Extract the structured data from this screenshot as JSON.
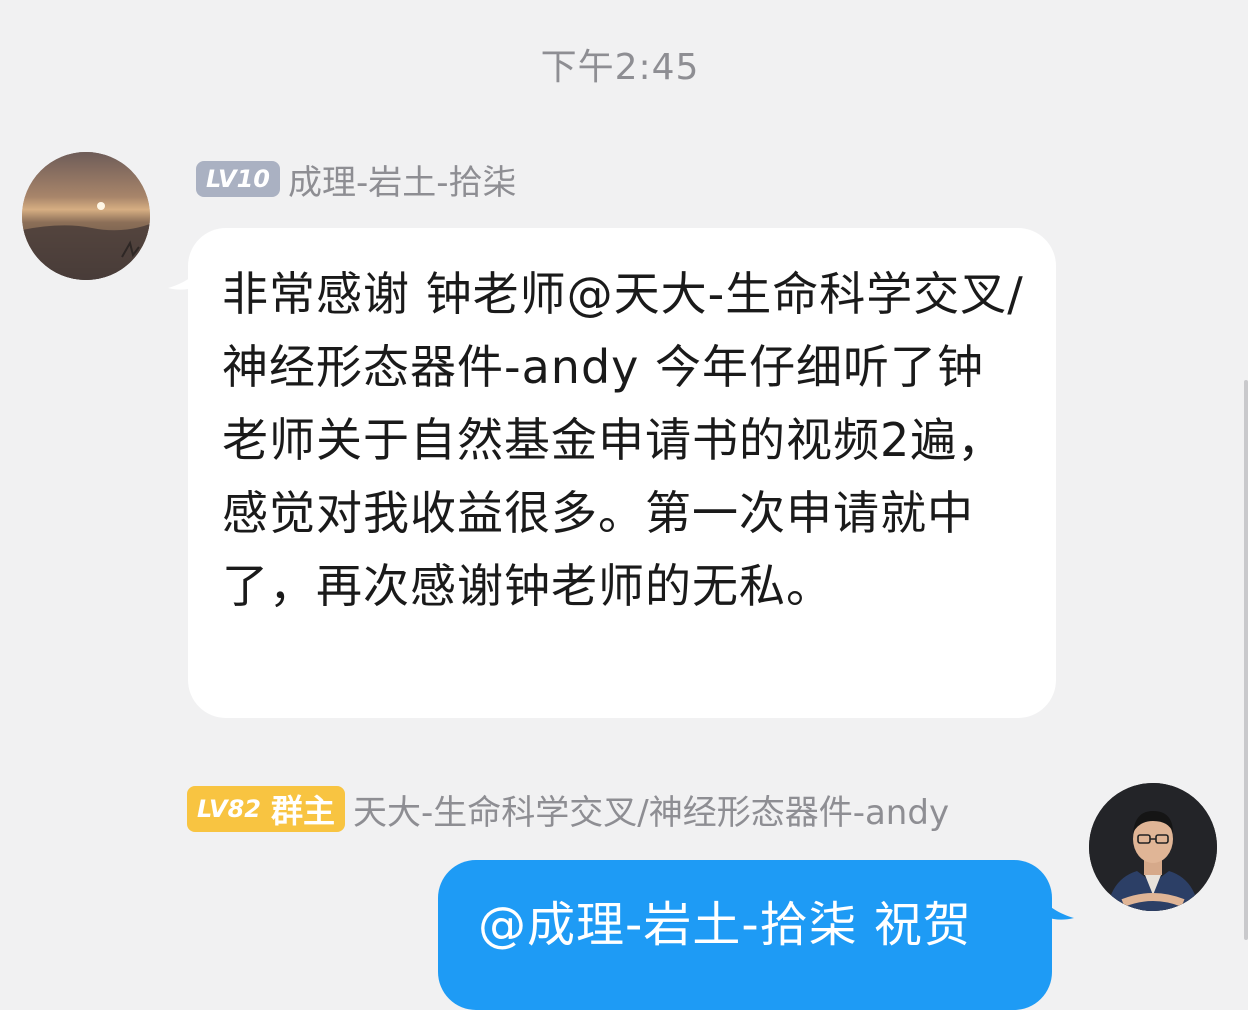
{
  "timestamp": "下午2:45",
  "incoming": {
    "level": "LV10",
    "sender": "成理-岩土-拾柒",
    "text": "非常感谢 钟老师@天大-生命科学交叉/神经形态器件-andy 今年仔细听了钟老师关于自然基金申请书的视频2遍，感觉对我收益很多。第一次申请就中了，再次感谢钟老师的无私。",
    "avatar_icon": "sunset-avatar"
  },
  "outgoing": {
    "level": "LV82",
    "role": "群主",
    "sender": "天大-生命科学交叉/神经形态器件-andy",
    "text": "@成理-岩土-拾柒 祝贺",
    "avatar_icon": "person-avatar"
  },
  "colors": {
    "background": "#f1f1f2",
    "incoming_bubble": "#ffffff",
    "outgoing_bubble": "#1e9bf5",
    "level_badge": "#aab1c2",
    "owner_badge": "#f8c441"
  }
}
